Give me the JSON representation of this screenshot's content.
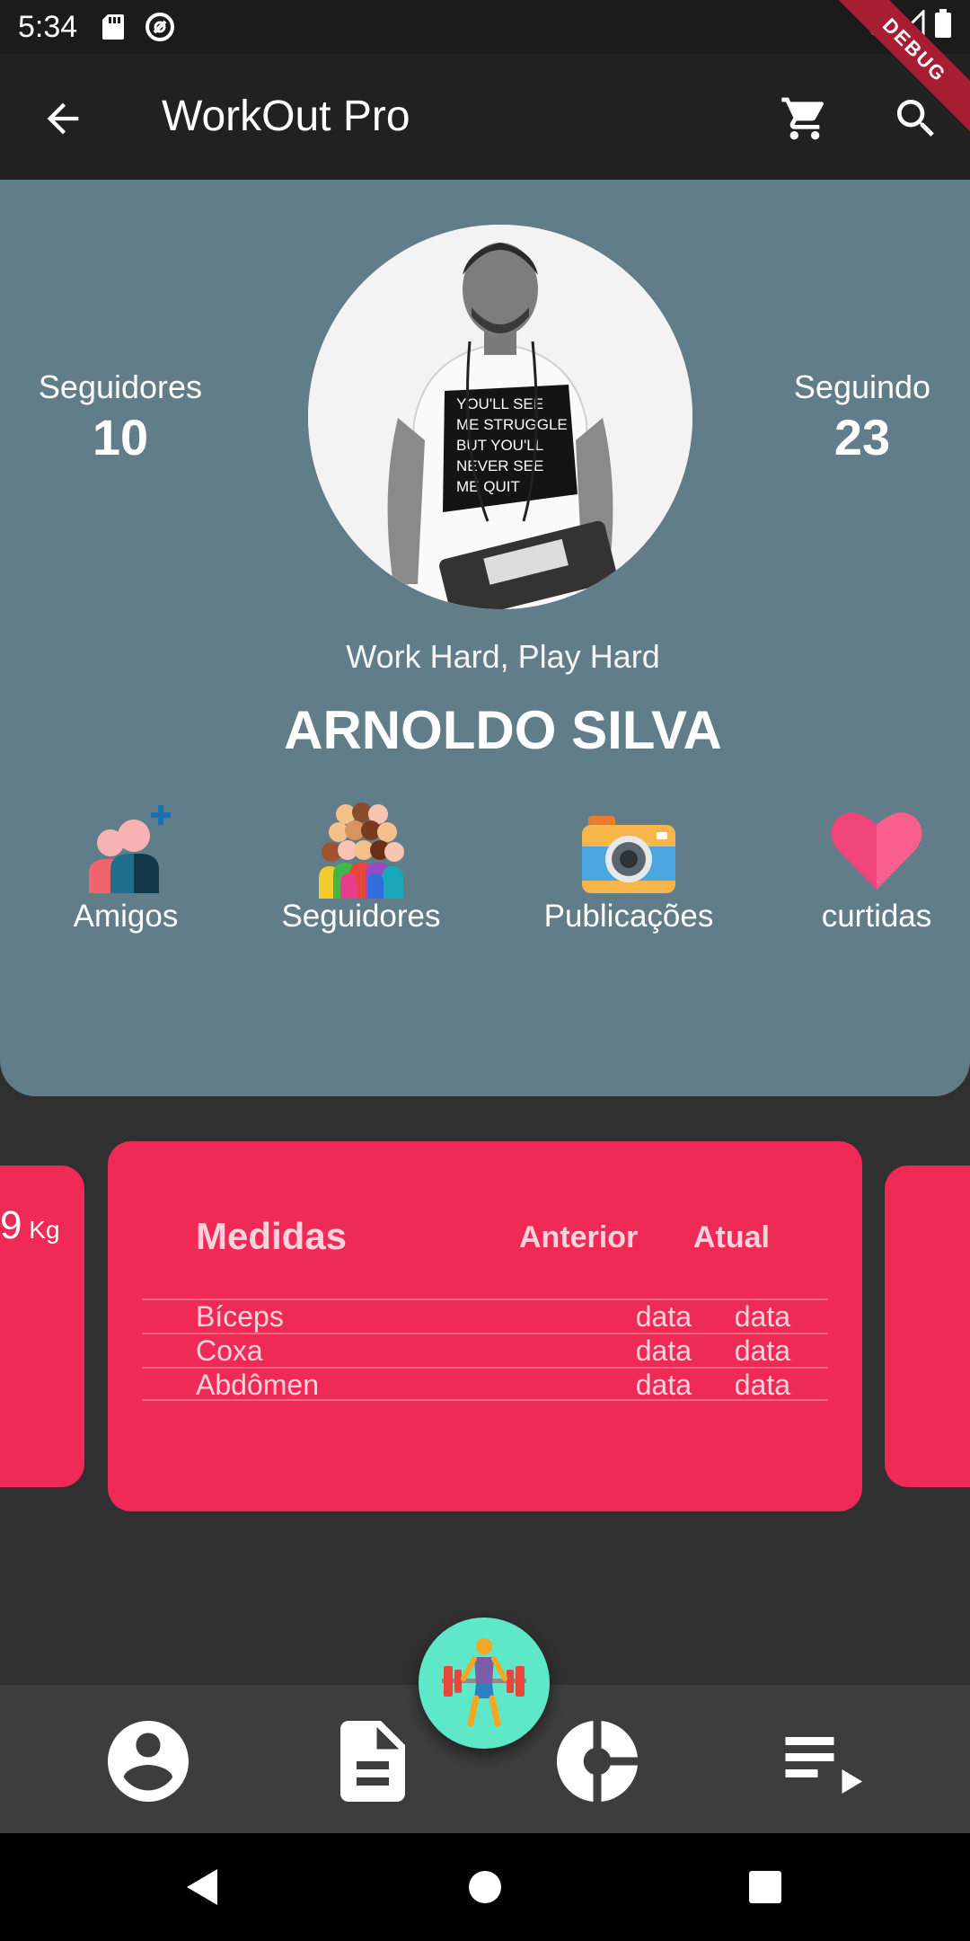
{
  "status_bar": {
    "time": "5:34"
  },
  "debug_banner": "DEBUG",
  "app_bar": {
    "title": "WorkOut Pro"
  },
  "profile": {
    "followers_label": "Seguidores",
    "followers_count": "10",
    "following_label": "Seguindo",
    "following_count": "23",
    "bio": "Work Hard, Play Hard",
    "name": "ARNOLDO SILVA",
    "photo_shirt_text": [
      "YOU'LL SEE",
      "ME STRUGGLE",
      "BUT YOU'LL",
      "NEVER SEE",
      "ME QUIT"
    ]
  },
  "actions": [
    {
      "label": "Amigos",
      "icon": "add-friends-icon"
    },
    {
      "label": "Seguidores",
      "icon": "crowd-icon"
    },
    {
      "label": "Publicações",
      "icon": "camera-icon"
    },
    {
      "label": "curtidas",
      "icon": "heart-icon"
    }
  ],
  "cards": {
    "left_partial": {
      "value": "9",
      "unit": "Kg"
    },
    "measures": {
      "title": "Medidas",
      "col_previous": "Anterior",
      "col_current": "Atual",
      "rows": [
        {
          "name": "Bíceps",
          "previous": "data",
          "current": "data"
        },
        {
          "name": "Coxa",
          "previous": "data",
          "current": "data"
        },
        {
          "name": "Abdômen",
          "previous": "data",
          "current": "data"
        }
      ]
    }
  },
  "bottom_nav": {
    "items": [
      "profile-icon",
      "document-icon",
      "chart-icon",
      "playlist-icon"
    ],
    "fab_icon": "weightlifter-icon"
  },
  "colors": {
    "profile_bg": "#617d8a",
    "card": "#ef2a56",
    "fab": "#5ee8c8",
    "app_bar": "#212121"
  }
}
